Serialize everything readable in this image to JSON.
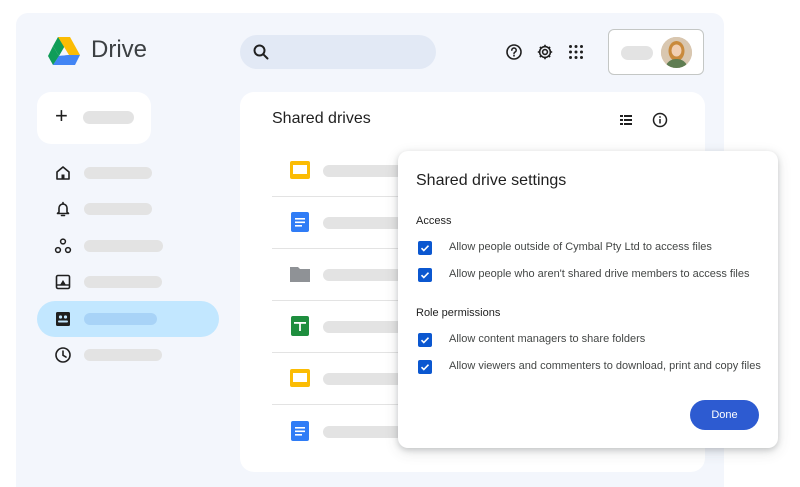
{
  "app": {
    "brand": "Drive"
  },
  "main": {
    "title": "Shared drives"
  },
  "dialog": {
    "title": "Shared drive settings",
    "sections": [
      {
        "heading": "Access",
        "options": [
          {
            "label": "Allow people outside of Cymbal Pty Ltd to access files",
            "checked": true
          },
          {
            "label": "Allow people who aren't shared drive members to access files",
            "checked": true
          }
        ]
      },
      {
        "heading": "Role permissions",
        "options": [
          {
            "label": "Allow content managers to share folders",
            "checked": true
          },
          {
            "label": "Allow viewers and commenters to download, print and copy files",
            "checked": true
          }
        ]
      }
    ],
    "done_label": "Done"
  },
  "colors": {
    "accent": "#0b57d0",
    "active_nav": "#c2e7ff",
    "done_button": "#2d5bd1"
  },
  "icons": {
    "header": [
      "help-icon",
      "settings-icon",
      "apps-grid-icon"
    ],
    "nav": [
      "home-icon",
      "bell-icon",
      "workspaces-icon",
      "my-drive-icon",
      "shared-drives-icon",
      "recent-icon"
    ],
    "rows": [
      "slides-file-icon",
      "docs-file-icon",
      "folder-icon",
      "sheets-file-icon",
      "slides-file-icon",
      "docs-file-icon"
    ]
  }
}
